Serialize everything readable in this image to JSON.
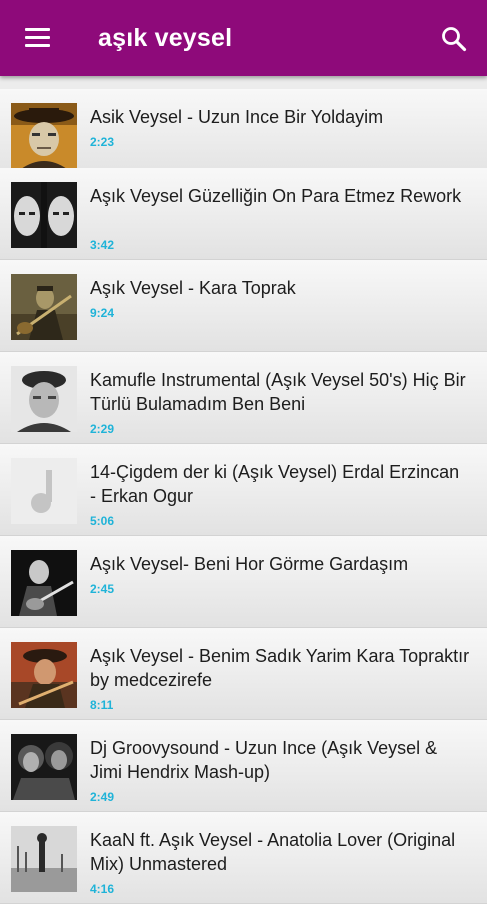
{
  "header": {
    "title": "aşık veysel",
    "background_color": "#8e0a7a",
    "menu_icon": "hamburger-menu-icon",
    "search_icon": "search-icon"
  },
  "duration_color": "#1fb3d8",
  "tracks": [
    {
      "title": "Asik Veysel - Uzun Ince Bir Yoldayim",
      "duration": "2:23"
    },
    {
      "title": "Aşık Veysel Güzelliğin On Para Etmez Rework",
      "duration": "3:42"
    },
    {
      "title": "Aşık Veysel - Kara Toprak",
      "duration": "9:24"
    },
    {
      "title": "Kamufle Instrumental (Aşık Veysel 50's) Hiç Bir Türlü Bulamadım Ben Beni",
      "duration": "2:29"
    },
    {
      "title": "14-Çigdem der ki (Aşık Veysel) Erdal Erzincan - Erkan Ogur",
      "duration": "5:06"
    },
    {
      "title": "Aşık Veysel- Beni Hor Görme Gardaşım",
      "duration": "2:45"
    },
    {
      "title": "Aşık Veysel - Benim Sadık Yarim Kara Topraktır by medcezirefe",
      "duration": "8:11"
    },
    {
      "title": "Dj Groovysound - Uzun Ince (Aşık Veysel & Jimi Hendrix Mash-up)",
      "duration": "2:49"
    },
    {
      "title": "KaaN ft. Aşık Veysel - Anatolia Lover (Original Mix) Unmastered",
      "duration": "4:16"
    }
  ]
}
